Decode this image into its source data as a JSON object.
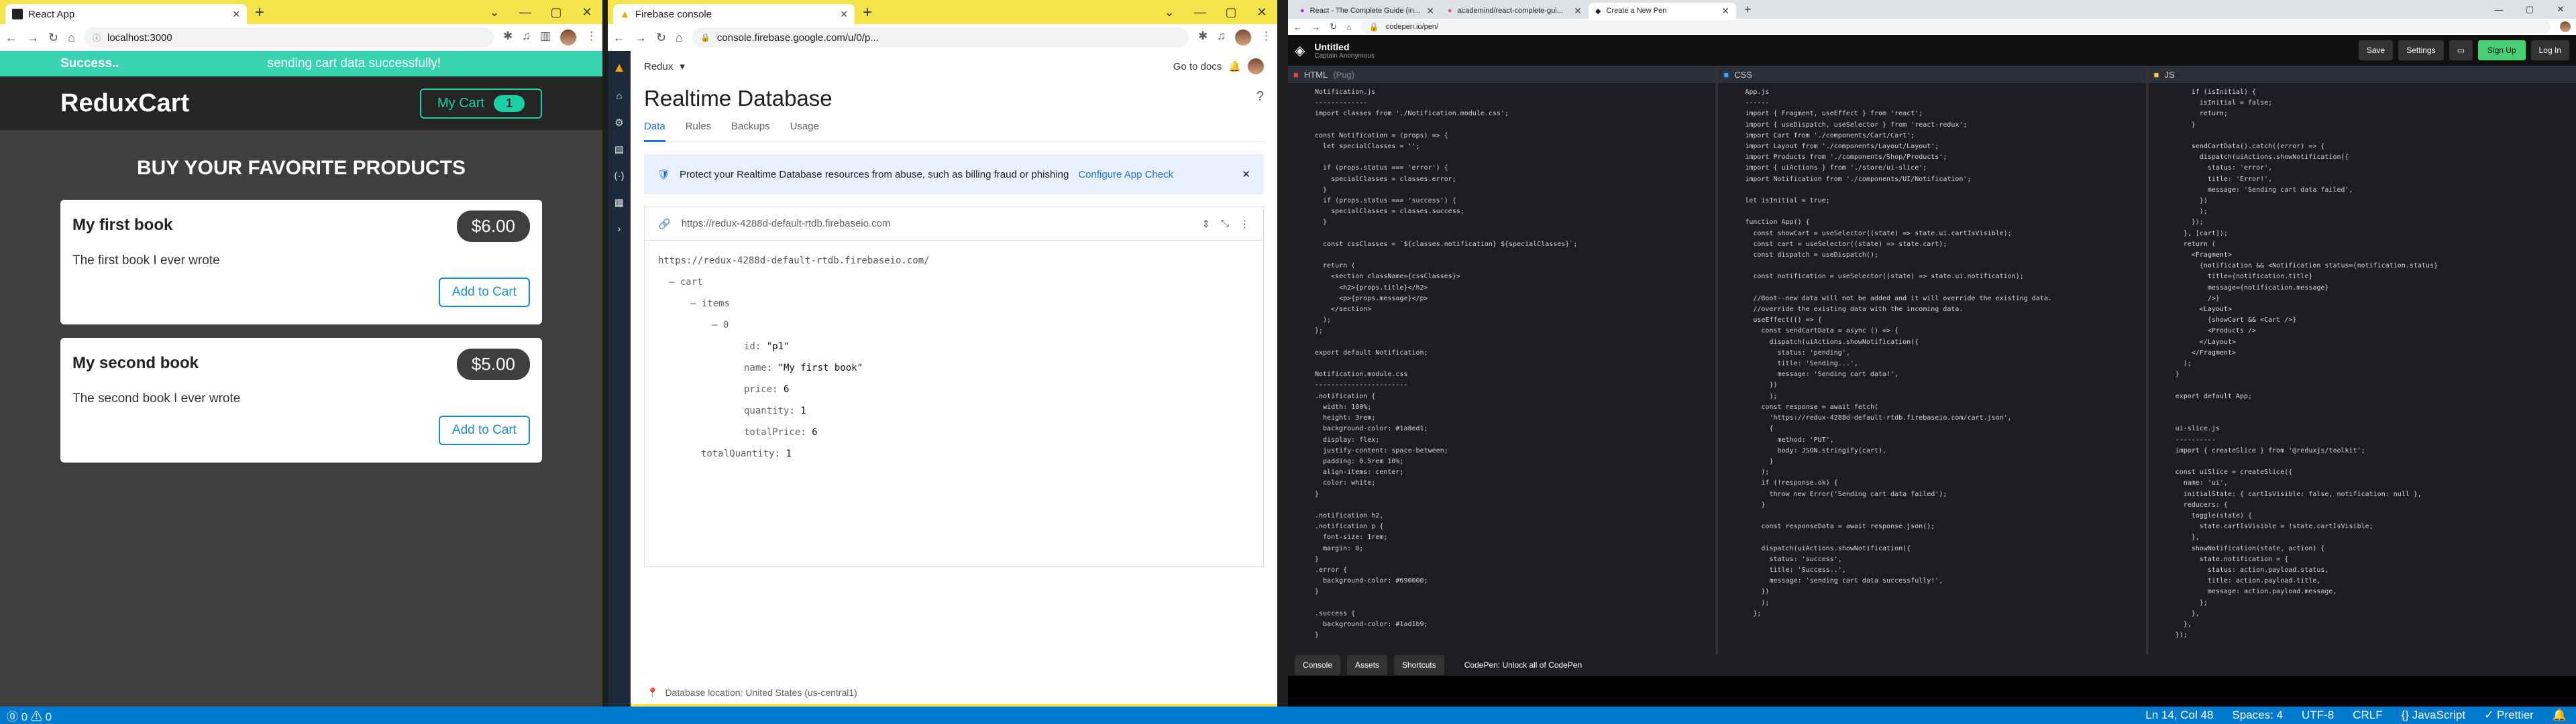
{
  "win1": {
    "tab_title": "React App",
    "url": "localhost:3000",
    "notification": {
      "title": "Success..",
      "message": "sending cart data successfully!"
    },
    "app_title": "ReduxCart",
    "cart_label": "My Cart",
    "cart_count": "1",
    "heading": "BUY YOUR FAVORITE PRODUCTS",
    "products": [
      {
        "title": "My first book",
        "price": "$6.00",
        "desc": "The first book I ever wrote",
        "btn": "Add to Cart"
      },
      {
        "title": "My second book",
        "price": "$5.00",
        "desc": "The second book I ever wrote",
        "btn": "Add to Cart"
      }
    ]
  },
  "win2": {
    "tab_title": "Firebase console",
    "url": "console.firebase.google.com/u/0/p...",
    "project": "Redux",
    "goto_docs": "Go to docs",
    "page_title": "Realtime Database",
    "tabs": [
      "Data",
      "Rules",
      "Backups",
      "Usage"
    ],
    "notice": "Protect your Realtime Database resources from abuse, such as billing fraud or phishing",
    "notice_link": "Configure App Check",
    "db_url": "https://redux-4288d-default-rtdb.firebaseio.com",
    "tree": {
      "root": "https://redux-4288d-default-rtdb.firebaseio.com/",
      "cart": "cart",
      "items": "items",
      "idx": "0",
      "fields": [
        {
          "k": "id",
          "v": "\"p1\""
        },
        {
          "k": "name",
          "v": "\"My first book\""
        },
        {
          "k": "price",
          "v": "6"
        },
        {
          "k": "quantity",
          "v": "1"
        },
        {
          "k": "totalPrice",
          "v": "6"
        }
      ],
      "total": {
        "k": "totalQuantity",
        "v": "1"
      }
    },
    "location": "Database location: United States (us-central1)"
  },
  "win3": {
    "tabs": [
      "React - The Complete Guide (in...",
      "academind/react-complete-gui...",
      "Create a New Pen"
    ],
    "url": "codepen.io/pen/",
    "pen_title": "Untitled",
    "pen_author": "Captain Anonymous",
    "buttons": {
      "save": "Save",
      "settings": "Settings",
      "signup": "Sign Up",
      "login": "Log In"
    },
    "panes": [
      {
        "label": "HTML",
        "badge": "(Pug)",
        "code": "Notification.js\n-------------\nimport classes from './Notification.module.css';\n\nconst Notification = (props) => {\n  let specialClasses = '';\n\n  if (props.status === 'error') {\n    specialClasses = classes.error;\n  }\n  if (props.status === 'success') {\n    specialClasses = classes.success;\n  }\n\n  const cssClasses = `${classes.notification} ${specialClasses}`;\n\n  return (\n    <section className={cssClasses}>\n      <h2>{props.title}</h2>\n      <p>{props.message}</p>\n    </section>\n  );\n};\n\nexport default Notification;\n\nNotification.module.css\n-----------------------\n.notification {\n  width: 100%;\n  height: 3rem;\n  background-color: #1a8ed1;\n  display: flex;\n  justify-content: space-between;\n  padding: 0.5rem 10%;\n  align-items: center;\n  color: white;\n}\n\n.notification h2,\n.notification p {\n  font-size: 1rem;\n  margin: 0;\n}\n.error {\n  background-color: #690000;\n}\n\n.success {\n  background-color: #1ad1b9;\n}"
      },
      {
        "label": "CSS",
        "badge": "",
        "code": "App.js\n------\nimport { Fragment, useEffect } from 'react';\nimport { useDispatch, useSelector } from 'react-redux';\nimport Cart from './components/Cart/Cart';\nimport Layout from './components/Layout/Layout';\nimport Products from './components/Shop/Products';\nimport { uiActions } from './store/ui-slice';\nimport Notification from './components/UI/Notification';\n\nlet isInitial = true;\n\nfunction App() {\n  const showCart = useSelector((state) => state.ui.cartIsVisible);\n  const cart = useSelector((state) => state.cart);\n  const dispatch = useDispatch();\n\n  const notification = useSelector((state) => state.ui.notification);\n\n  //Boot--new data will not be added and it will override the existing data.\n  //override the existing data with the incoming data.\n  useEffect(() => {\n    const sendCartData = async () => {\n      dispatch(uiActions.showNotification({\n        status: 'pending',\n        title: 'Sending...',\n        message: 'Sending cart data!',\n      })\n      );\n    const response = await fetch(\n      'https://redux-4288d-default-rtdb.firebaseio.com/cart.json',\n      {\n        method: 'PUT',\n        body: JSON.stringify(cart),\n      }\n    );\n    if (!response.ok) {\n      throw new Error('Sending cart data failed');\n    }\n\n    const responseData = await response.json();\n\n    dispatch(uiActions.showNotification({\n      status: 'success',\n      title: 'Success..',\n      message: 'sending cart data successfully!',\n    })\n    );\n  };"
      },
      {
        "label": "JS",
        "badge": "",
        "code": "    if (isInitial) {\n      isInitial = false;\n      return;\n    }\n\n    sendCartData().catch((error) => {\n      dispatch(uiActions.showNotification({\n        status: 'error',\n        title: 'Error!',\n        message: 'Sending cart data failed',\n      })\n      );\n    });\n  }, [cart]);\n  return (\n    <Fragment>\n      {notification && <Notification status={notification.status}\n        title={notification.title}\n        message={notification.message}\n        />}\n      <Layout>\n        {showCart && <Cart />}\n        <Products />\n      </Layout>\n    </Fragment>\n  );\n}\n\nexport default App;\n\n\nui-slice.js\n----------\nimport { createSlice } from '@reduxjs/toolkit';\n\nconst uiSlice = createSlice({\n  name: 'ui',\n  initialState: { cartIsVisible: false, notification: null },\n  reducers: {\n    toggle(state) {\n      state.cartIsVisible = !state.cartIsVisible;\n    },\n    showNotification(state, action) {\n      state.notification = {\n        status: action.payload.status,\n        title: action.payload.title,\n        message: action.payload.message,\n      };\n    },\n  },\n});"
      }
    ],
    "console": [
      "Console",
      "Assets",
      "Shortcuts"
    ],
    "promo": "CodePen: Unlock all of CodePen"
  },
  "statusbar": {
    "problems": "⓪ 0 ⚠ 0",
    "position": "Ln 14, Col 48",
    "spaces": "Spaces: 4",
    "encoding": "UTF-8",
    "eol": "CRLF",
    "lang": "{} JavaScript",
    "prettier": "✓ Prettier"
  }
}
